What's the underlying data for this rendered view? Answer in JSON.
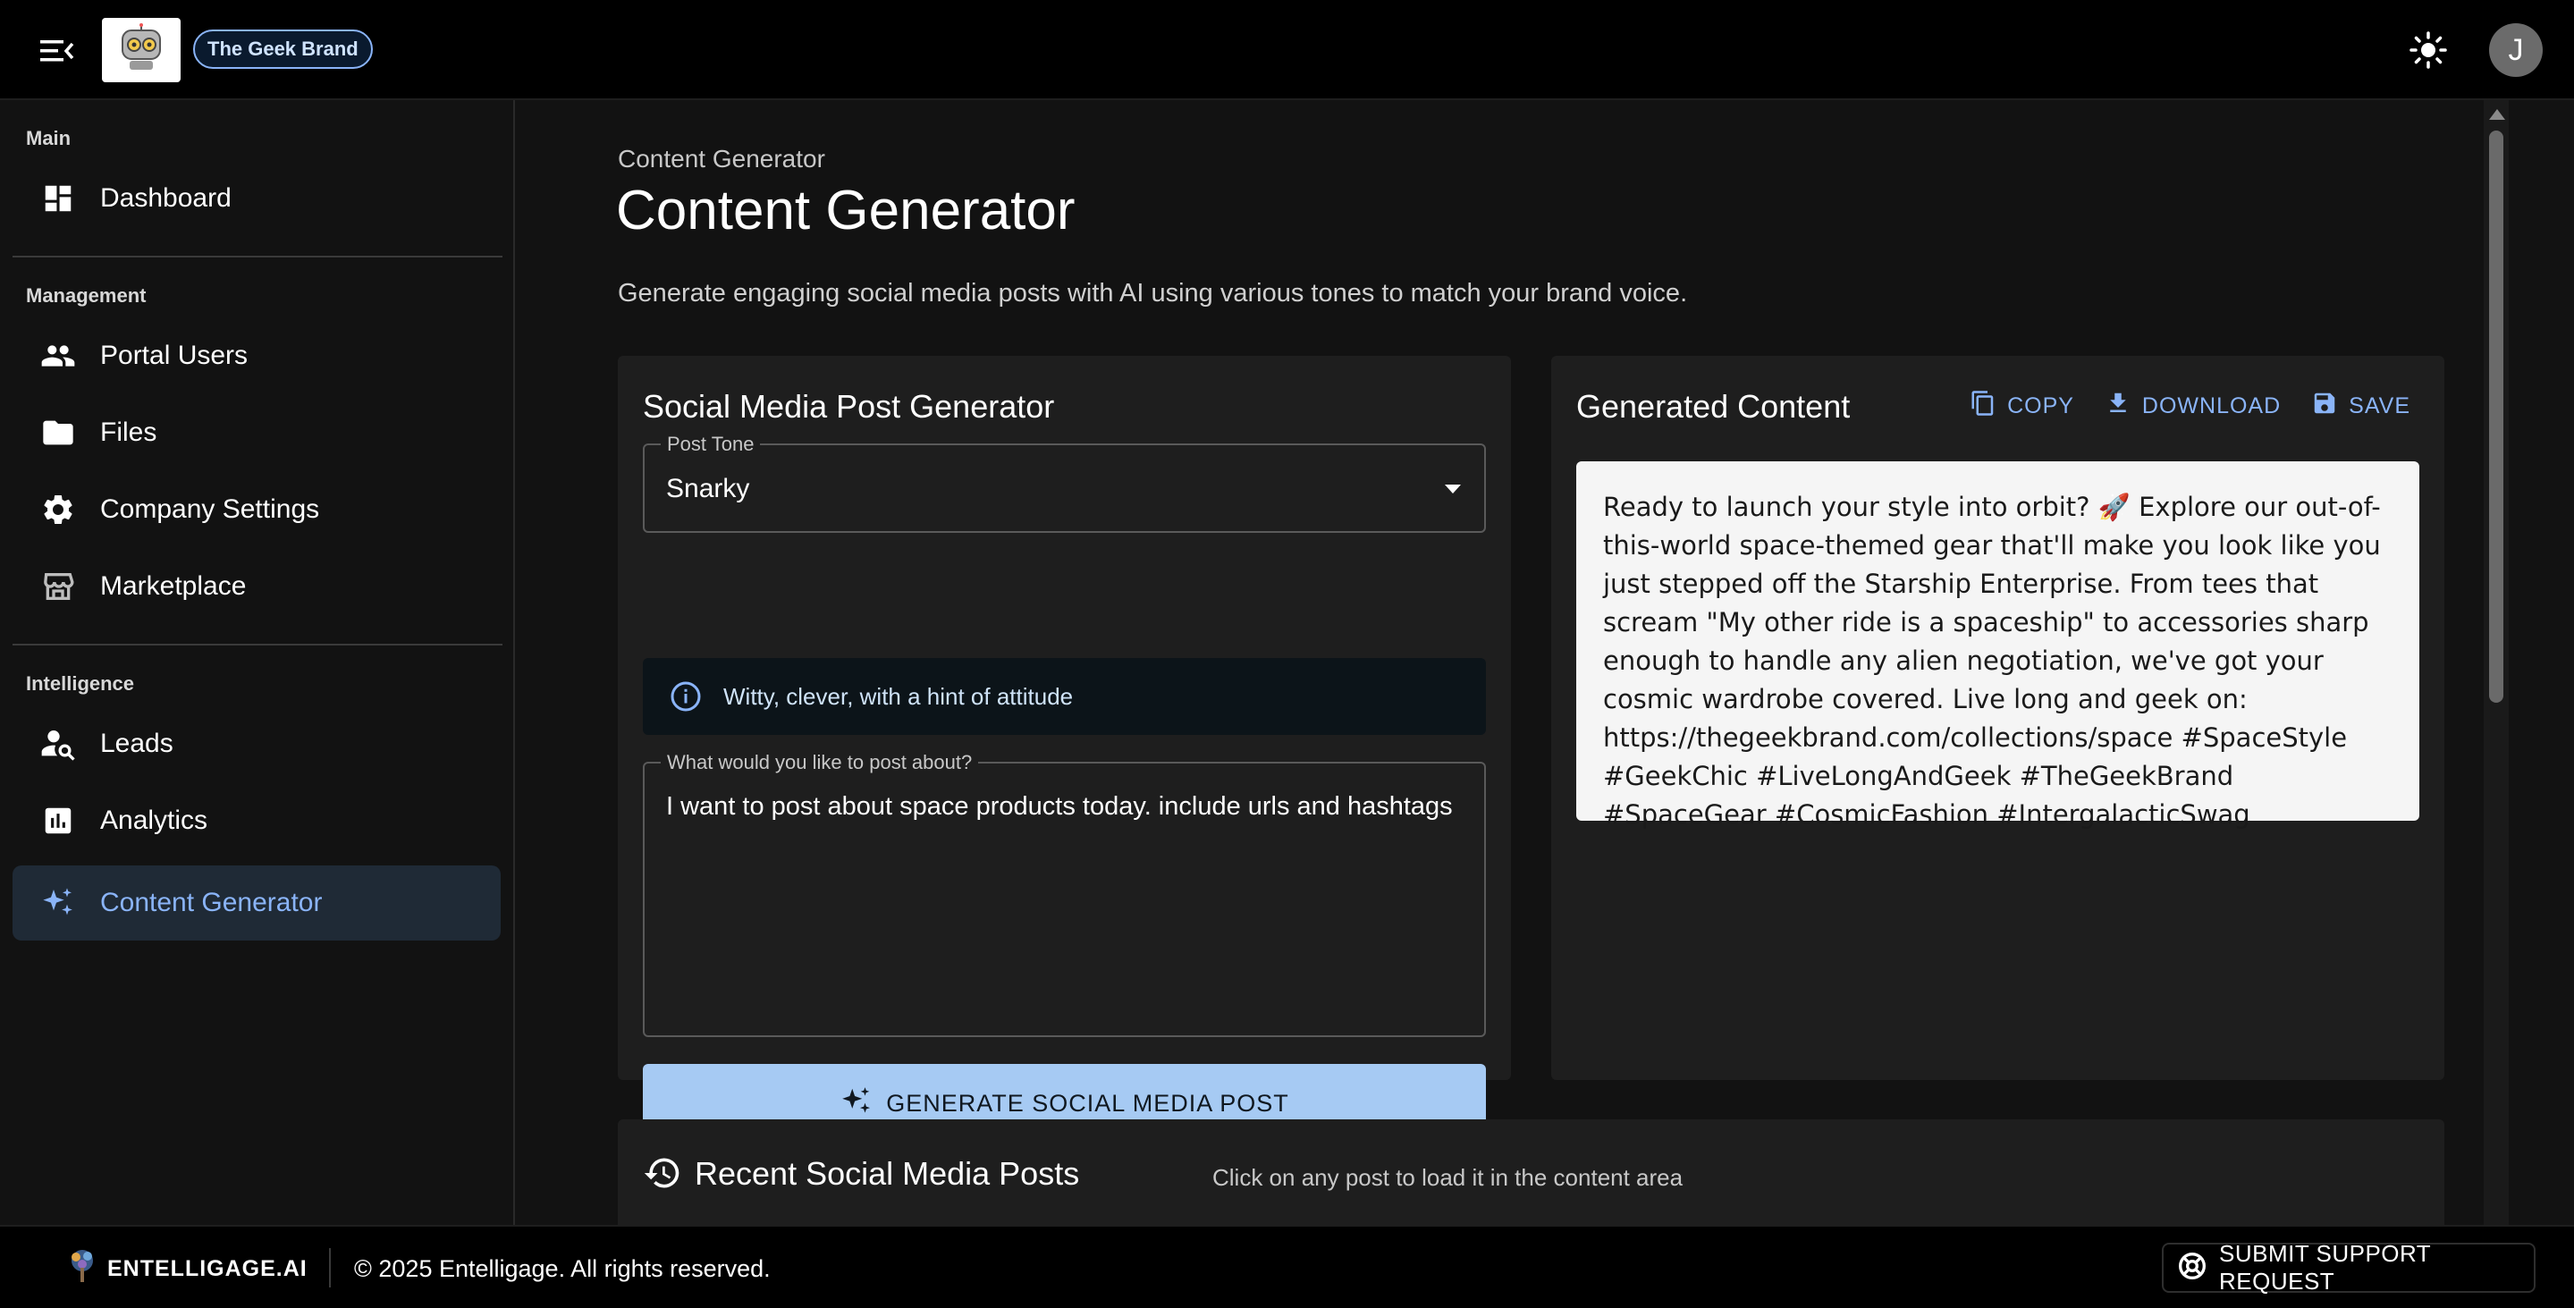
{
  "header": {
    "brand_name": "The Geek Brand",
    "avatar_initial": "J"
  },
  "sidebar": {
    "sections": {
      "main": "Main",
      "management": "Management",
      "intelligence": "Intelligence"
    },
    "items": [
      {
        "label": "Dashboard",
        "icon": "dashboard-icon"
      },
      {
        "label": "Portal Users",
        "icon": "people-icon"
      },
      {
        "label": "Files",
        "icon": "folder-icon"
      },
      {
        "label": "Company Settings",
        "icon": "gear-icon"
      },
      {
        "label": "Marketplace",
        "icon": "store-icon"
      },
      {
        "label": "Leads",
        "icon": "person-search-icon"
      },
      {
        "label": "Analytics",
        "icon": "bar-chart-icon"
      },
      {
        "label": "Content Generator",
        "icon": "sparkle-icon",
        "active": true
      }
    ]
  },
  "page": {
    "breadcrumb": "Content Generator",
    "title": "Content Generator",
    "description": "Generate engaging social media posts with AI using various tones to match your brand voice."
  },
  "generator": {
    "title": "Social Media Post Generator",
    "tone_label": "Post Tone",
    "tone_value": "Snarky",
    "tone_description": "Witty, clever, with a hint of attitude",
    "prompt_label": "What would you like to post about?",
    "prompt_value": "I want to post about space products today. include urls and hashtags",
    "generate_label": "GENERATE SOCIAL MEDIA POST"
  },
  "output": {
    "title": "Generated Content",
    "copy_label": "COPY",
    "download_label": "DOWNLOAD",
    "save_label": "SAVE",
    "content": "Ready to launch your style into orbit? 🚀 Explore our out-of-this-world space-themed gear that'll make you look like you just stepped off the Starship Enterprise. From tees that scream \"My other ride is a spaceship\" to accessories sharp enough to handle any alien negotiation, we've got your cosmic wardrobe covered. Live long and geek on: https://thegeekbrand.com/collections/space #SpaceStyle #GeekChic #LiveLongAndGeek #TheGeekBrand #SpaceGear #CosmicFashion #IntergalacticSwag"
  },
  "recent": {
    "title": "Recent Social Media Posts",
    "hint": "Click on any post to load it in the content area"
  },
  "footer": {
    "brand": "ENTELLIGAGE.AI",
    "copyright": "© 2025 Entelligage. All rights reserved.",
    "support_label": "SUBMIT SUPPORT REQUEST"
  },
  "colors": {
    "accent": "#8ab4f8",
    "button": "#a6caf3",
    "background": "#121212",
    "card": "#1e1e1e"
  }
}
